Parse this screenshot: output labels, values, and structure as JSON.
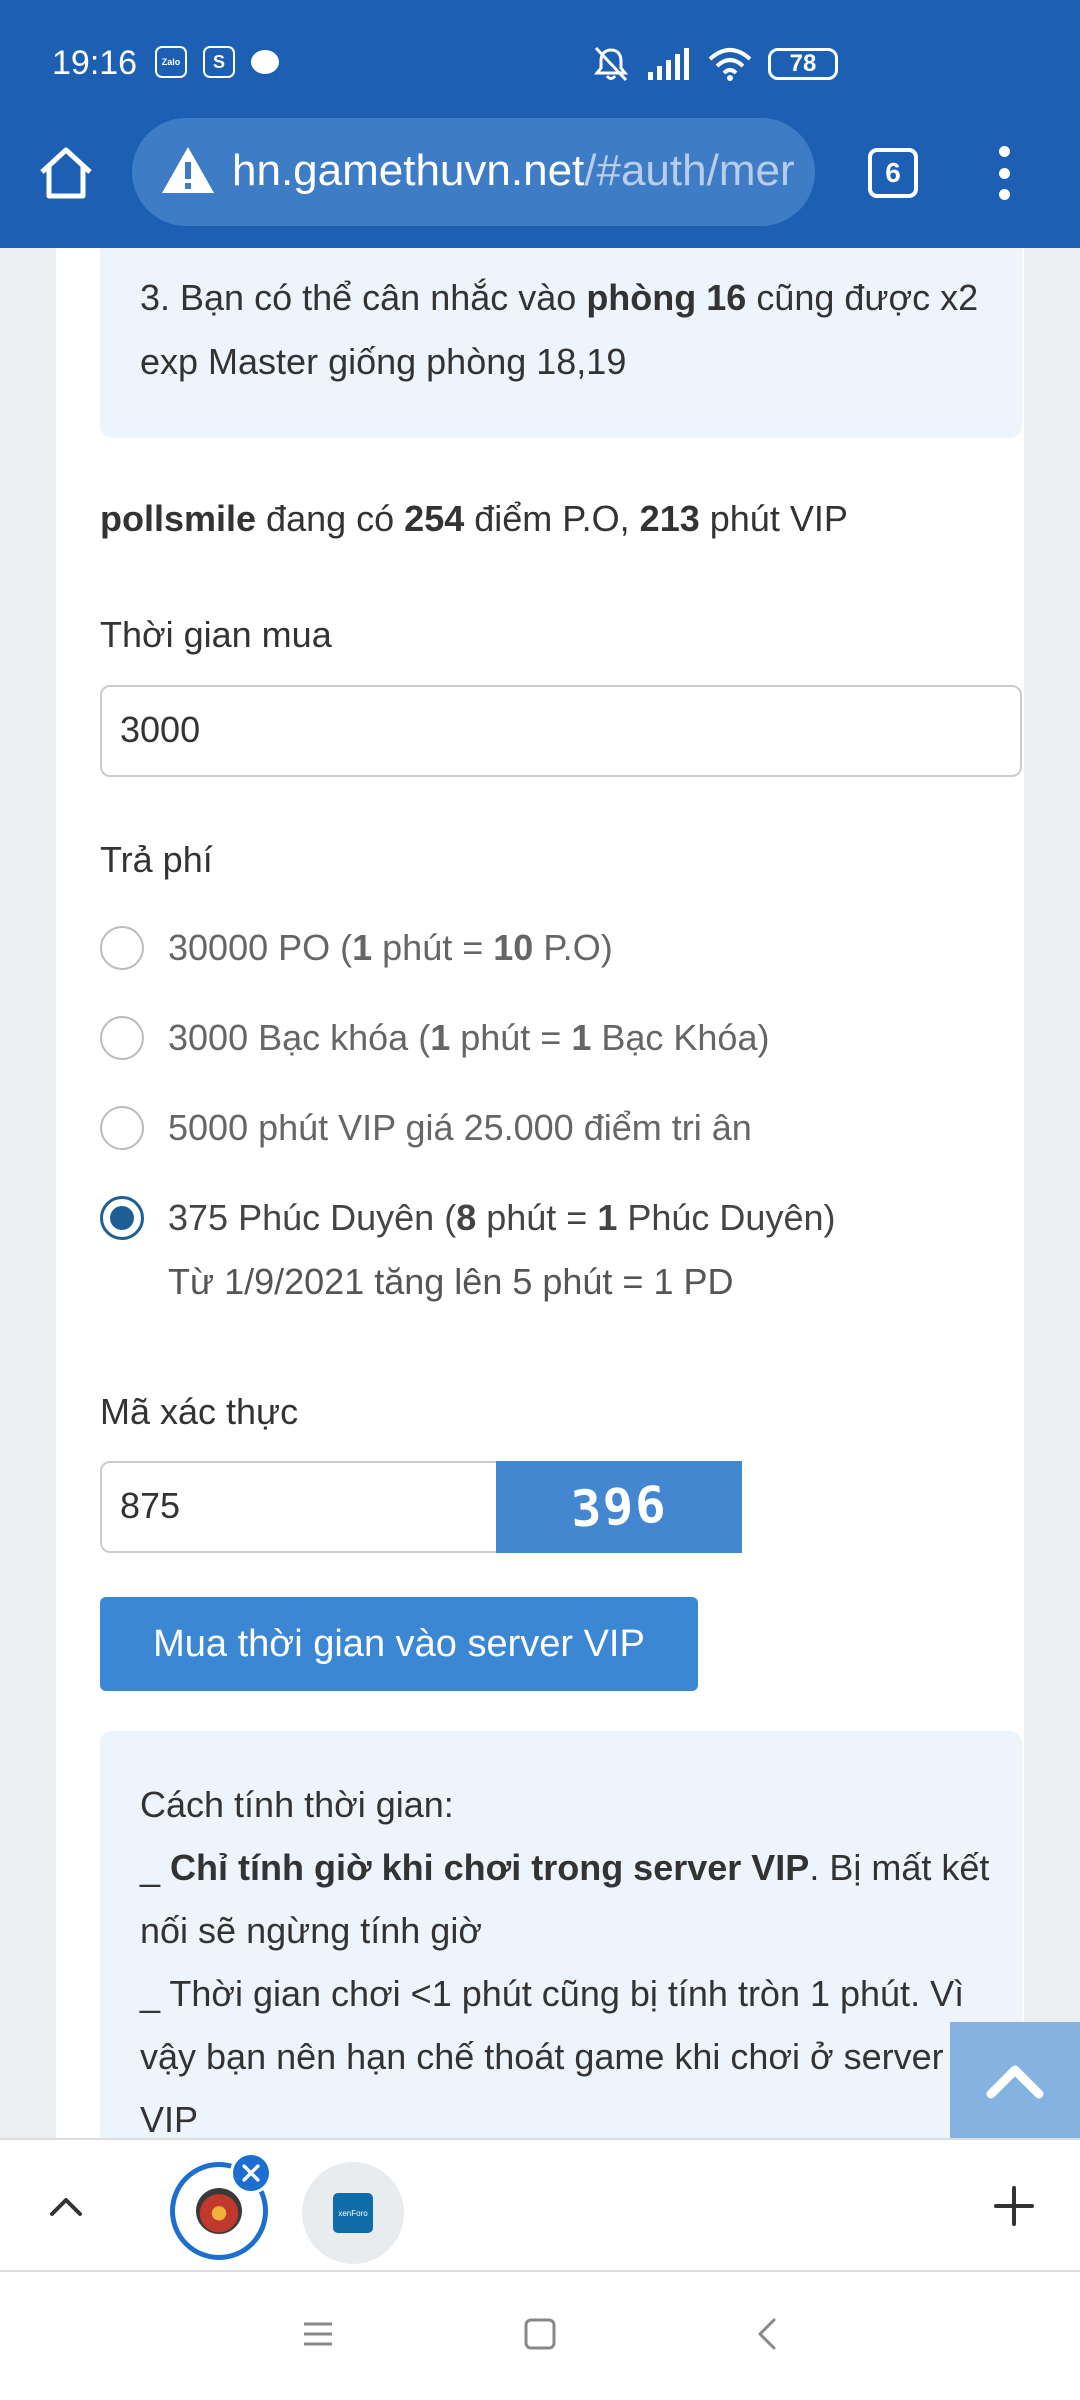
{
  "status_bar": {
    "time": "19:16",
    "app1": "Zalo",
    "app2": "S",
    "battery": "78"
  },
  "browser": {
    "url_host": "hn.gamethuvn.net",
    "url_path": "/#auth/mer",
    "tab_count": "6"
  },
  "notice": {
    "prefix": "3. Bạn có thể cân nhắc vào ",
    "bold": "phòng 16",
    "suffix": " cũng được x2 exp Master giống phòng 18,19"
  },
  "balance": {
    "username": "pollsmile",
    "text1": " đang có ",
    "points": "254",
    "text2": " điểm P.O, ",
    "vip_minutes": "213",
    "text3": " phút VIP"
  },
  "form": {
    "time_label": "Thời gian mua",
    "time_value": "3000",
    "pay_label": "Trả phí",
    "options": [
      {
        "a": "30000 PO (",
        "b": "1",
        "c": " phút = ",
        "d": "10",
        "e": " P.O)",
        "checked": false
      },
      {
        "a": "3000 Bạc khóa (",
        "b": "1",
        "c": " phút = ",
        "d": "1",
        "e": " Bạc Khóa)",
        "checked": false
      },
      {
        "a": "5000 phút VIP giá 25.000 điểm tri ân",
        "b": "",
        "c": "",
        "d": "",
        "e": "",
        "checked": false
      },
      {
        "a": "375 Phúc Duyên (",
        "b": "8",
        "c": " phút = ",
        "d": "1",
        "e": " Phúc Duyên)",
        "checked": true,
        "sub": "Từ 1/9/2021 tăng lên 5 phút = 1 PD"
      }
    ],
    "captcha_label": "Mã xác thực",
    "captcha_value": "875",
    "captcha_image_text": "396",
    "submit_label": "Mua thời gian vào server VIP"
  },
  "info": {
    "title": "Cách tính thời gian:",
    "line1_prefix": "_ ",
    "line1_bold": "Chỉ tính giờ khi chơi trong server VIP",
    "line1_rest": ". Bị mất kết nối sẽ ngừng tính giờ",
    "line2": "_ Thời gian chơi <1 phút cũng bị tính tròn 1 phút. Vì vậy bạn nên hạn chế thoát game khi chơi ở server VIP"
  },
  "tabs": {
    "tab2_label": "xenForo"
  },
  "colors": {
    "browser_bar": "#1c5fb3",
    "button": "#3b87d4",
    "radio_checked": "#1d5f94",
    "notice_bg": "#eef4fb"
  }
}
